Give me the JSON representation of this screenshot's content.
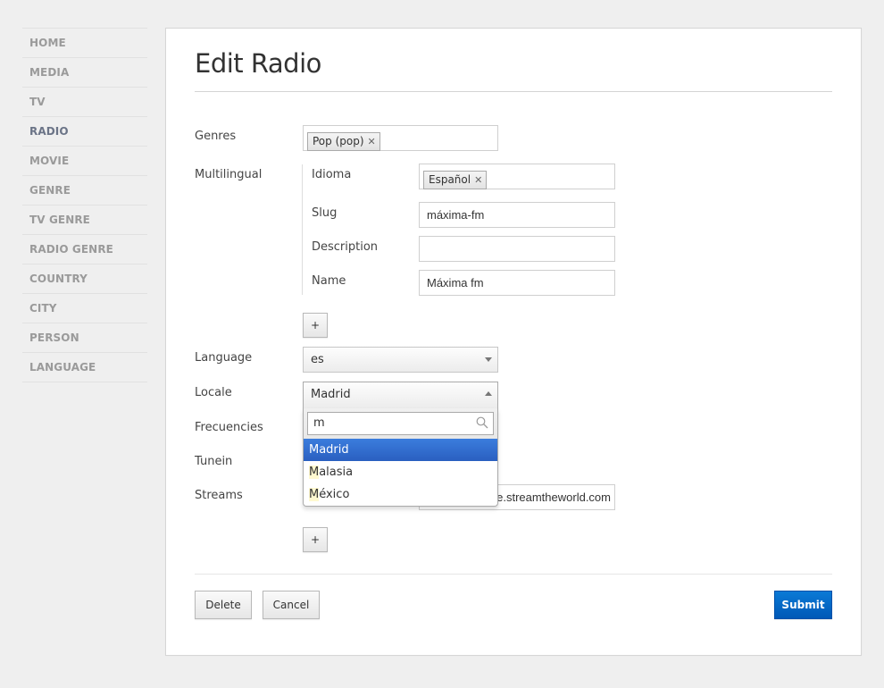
{
  "sidebar": {
    "items": [
      {
        "label": "HOME",
        "active": false
      },
      {
        "label": "MEDIA",
        "active": false
      },
      {
        "label": "TV",
        "active": false
      },
      {
        "label": "RADIO",
        "active": true
      },
      {
        "label": "MOVIE",
        "active": false
      },
      {
        "label": "GENRE",
        "active": false
      },
      {
        "label": "TV GENRE",
        "active": false
      },
      {
        "label": "RADIO GENRE",
        "active": false
      },
      {
        "label": "COUNTRY",
        "active": false
      },
      {
        "label": "CITY",
        "active": false
      },
      {
        "label": "PERSON",
        "active": false
      },
      {
        "label": "LANGUAGE",
        "active": false
      }
    ]
  },
  "page": {
    "title": "Edit Radio"
  },
  "form": {
    "genres": {
      "label": "Genres",
      "tags": [
        "Pop (pop)"
      ]
    },
    "multilingual": {
      "label": "Multilingual",
      "idioma": {
        "label": "Idioma",
        "tags": [
          "Español"
        ]
      },
      "slug": {
        "label": "Slug",
        "value": "máxima-fm"
      },
      "description": {
        "label": "Description",
        "value": ""
      },
      "name": {
        "label": "Name",
        "value": "Máxima fm"
      },
      "add_label": "+"
    },
    "language": {
      "label": "Language",
      "value": "es"
    },
    "locale": {
      "label": "Locale",
      "value": "Madrid",
      "search_value": "m",
      "options": [
        {
          "match": "M",
          "rest": "adrid",
          "highlighted": true
        },
        {
          "match": "M",
          "rest": "alasia",
          "highlighted": false
        },
        {
          "match": "M",
          "rest": "éxico",
          "highlighted": false
        }
      ]
    },
    "frecuencies": {
      "label": "Frecuencies"
    },
    "tunein": {
      "label": "Tunein"
    },
    "streams": {
      "label": "Streams",
      "value_visible": "e.streamtheworld.com",
      "add_label": "+"
    }
  },
  "actions": {
    "delete_label": "Delete",
    "cancel_label": "Cancel",
    "submit_label": "Submit"
  },
  "colors": {
    "primary": "#0a6fd0",
    "highlight": "#3472d6",
    "active_nav": "#6b7487"
  }
}
